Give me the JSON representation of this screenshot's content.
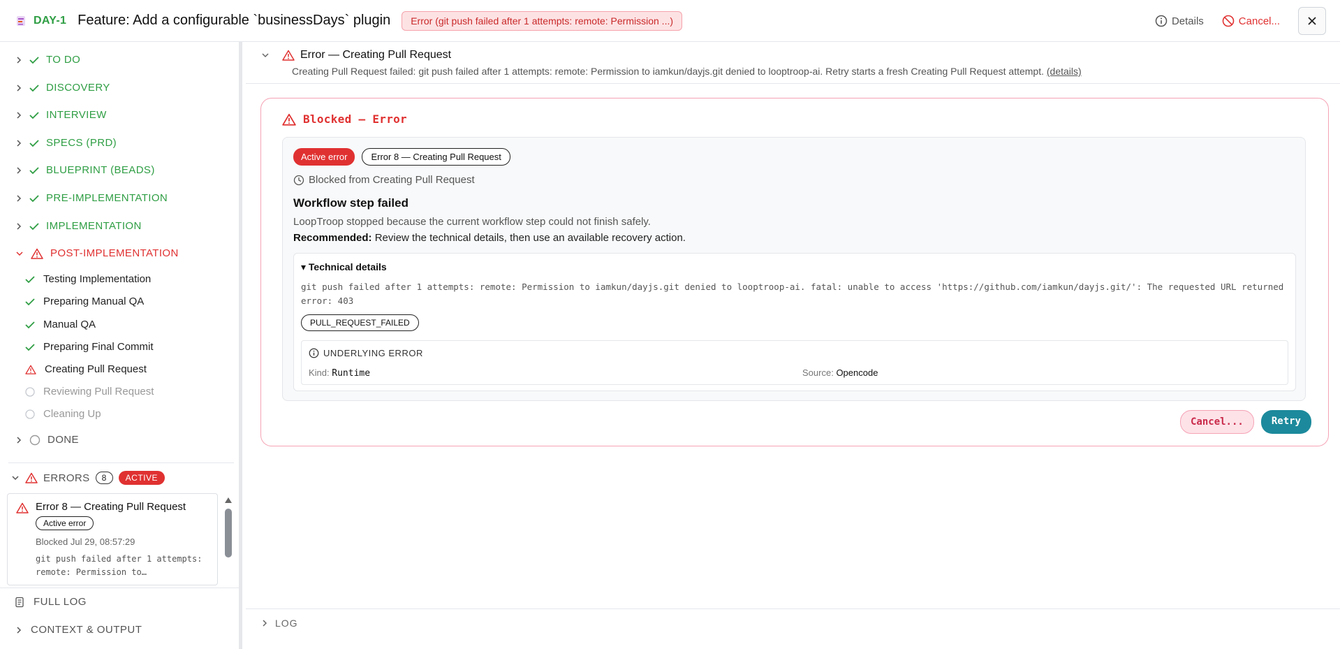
{
  "header": {
    "ticket_id": "DAY-1",
    "title": "Feature: Add a configurable `businessDays` plugin",
    "status": "Error (git push failed after 1 attempts: remote: Permission ...)",
    "details_label": "Details",
    "cancel_label": "Cancel..."
  },
  "sidebar": {
    "phases": [
      {
        "label": "TO DO"
      },
      {
        "label": "DISCOVERY"
      },
      {
        "label": "INTERVIEW"
      },
      {
        "label": "SPECS (PRD)"
      },
      {
        "label": "BLUEPRINT (BEADS)"
      },
      {
        "label": "PRE-IMPLEMENTATION"
      },
      {
        "label": "IMPLEMENTATION"
      },
      {
        "label": "POST-IMPLEMENTATION"
      },
      {
        "label": "DONE"
      }
    ],
    "substeps": [
      {
        "label": "Testing Implementation"
      },
      {
        "label": "Preparing Manual QA"
      },
      {
        "label": "Manual QA"
      },
      {
        "label": "Preparing Final Commit"
      },
      {
        "label": "Creating Pull Request"
      },
      {
        "label": "Reviewing Pull Request"
      },
      {
        "label": "Cleaning Up"
      }
    ],
    "errors": {
      "label": "ERRORS",
      "count": "8",
      "active_badge": "ACTIVE",
      "card": {
        "title": "Error 8 — Creating Pull Request",
        "badge": "Active error",
        "time": "Blocked Jul 29, 08:57:29",
        "message": "git push failed after 1 attempts: remote: Permission to…"
      }
    },
    "full_log": "FULL LOG",
    "context_output": "CONTEXT & OUTPUT"
  },
  "main": {
    "error_header": {
      "title": "Error — Creating Pull Request",
      "description": "Creating Pull Request failed: git push failed after 1 attempts: remote: Permission to iamkun/dayjs.git denied to looptroop-ai. Retry starts a fresh Creating Pull Request attempt.",
      "details_link": "(details)"
    },
    "blocked": {
      "title": "Blocked — Error",
      "active_pill": "Active error",
      "error_pill": "Error 8 — Creating Pull Request",
      "blocked_from": "Blocked from Creating Pull Request",
      "workflow_title": "Workflow step failed",
      "workflow_desc": "LoopTroop stopped because the current workflow step could not finish safely.",
      "recommended_label": "Recommended:",
      "recommended_text": "Review the technical details, then use an available recovery action.",
      "tech_summary": "▾ Technical details",
      "tech_message": "git push failed after 1 attempts: remote: Permission to iamkun/dayjs.git denied to looptroop-ai. fatal: unable to access 'https://github.com/iamkun/dayjs.git/': The requested URL returned error: 403",
      "code": "PULL_REQUEST_FAILED",
      "underlying_label": "UNDERLYING ERROR",
      "kind_label": "Kind:",
      "kind_value": "Runtime",
      "source_label": "Source:",
      "source_value": "Opencode",
      "cancel_btn": "Cancel...",
      "retry_btn": "Retry"
    },
    "log_label": "LOG"
  },
  "colors": {
    "done": "#2f9e44",
    "error": "#e03131",
    "retry": "#1c8a9c"
  }
}
